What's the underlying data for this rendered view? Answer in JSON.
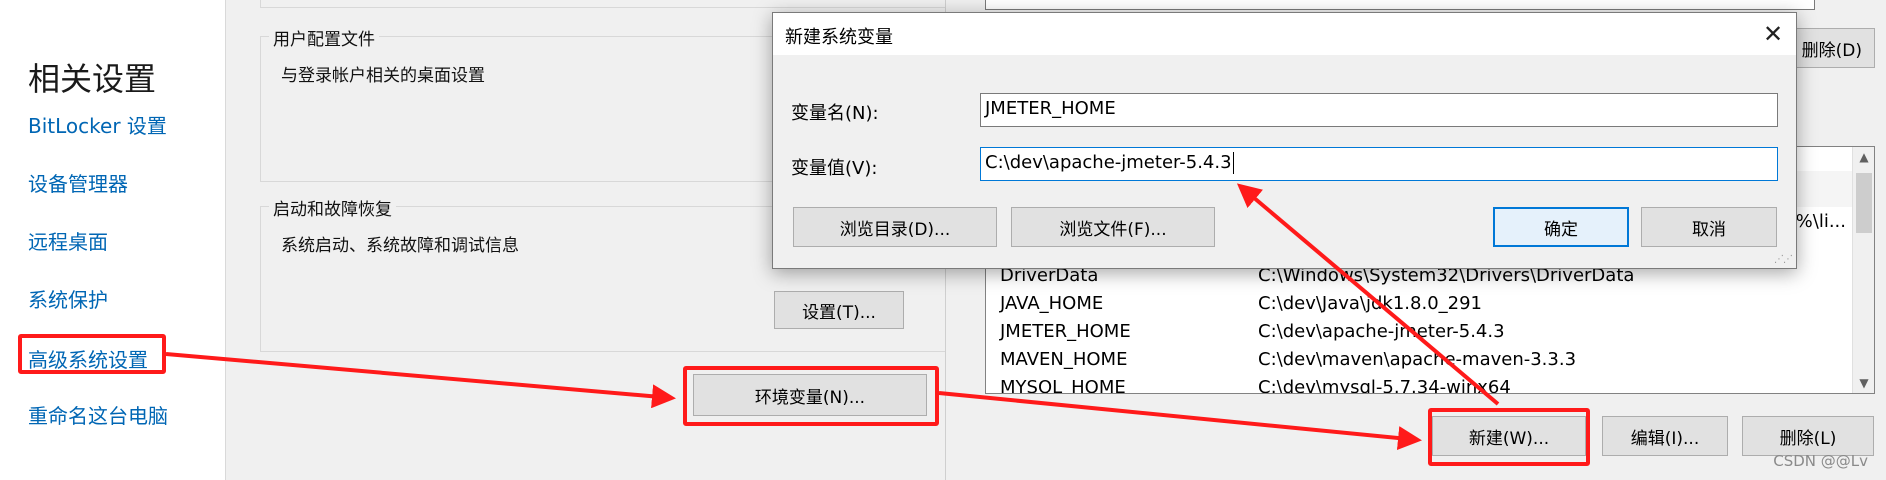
{
  "sidebar": {
    "title": "相关设置",
    "links": [
      "BitLocker 设置",
      "设备管理器",
      "远程桌面",
      "系统保护",
      "高级系统设置",
      "重命名这台电脑"
    ]
  },
  "system_properties": {
    "user_profiles": {
      "label": "用户配置文件",
      "desc": "与登录帐户相关的桌面设置"
    },
    "startup_recovery": {
      "label": "启动和故障恢复",
      "desc": "系统启动、系统故障和调试信息",
      "settings_button": "设置(T)..."
    },
    "env_vars_button": "环境变量(N)..."
  },
  "env_window": {
    "top_delete_button": "删除(D)",
    "clipped_value": "%\\li...",
    "variables": [
      {
        "name": "DriverData",
        "value": "C:\\Windows\\System32\\Drivers\\DriverData"
      },
      {
        "name": "JAVA_HOME",
        "value": "C:\\dev\\Java\\jdk1.8.0_291"
      },
      {
        "name": "JMETER_HOME",
        "value": "C:\\dev\\apache-jmeter-5.4.3"
      },
      {
        "name": "MAVEN_HOME",
        "value": "C:\\dev\\maven\\apache-maven-3.3.3"
      },
      {
        "name": "MYSQL_HOME",
        "value": "C:\\dev\\mysql-5.7.34-winx64"
      }
    ],
    "buttons": {
      "new": "新建(W)...",
      "edit": "编辑(I)...",
      "delete": "删除(L)"
    }
  },
  "dialog": {
    "title": "新建系统变量",
    "name_label": "变量名(N):",
    "name_value": "JMETER_HOME",
    "value_label": "变量值(V):",
    "value_value": "C:\\dev\\apache-jmeter-5.4.3",
    "browse_dir": "浏览目录(D)...",
    "browse_file": "浏览文件(F)...",
    "ok": "确定",
    "cancel": "取消"
  },
  "watermark": "CSDN @@Lv",
  "colors": {
    "highlight": "#ff1a1a",
    "link": "#0066b4",
    "focus": "#0078d7"
  }
}
